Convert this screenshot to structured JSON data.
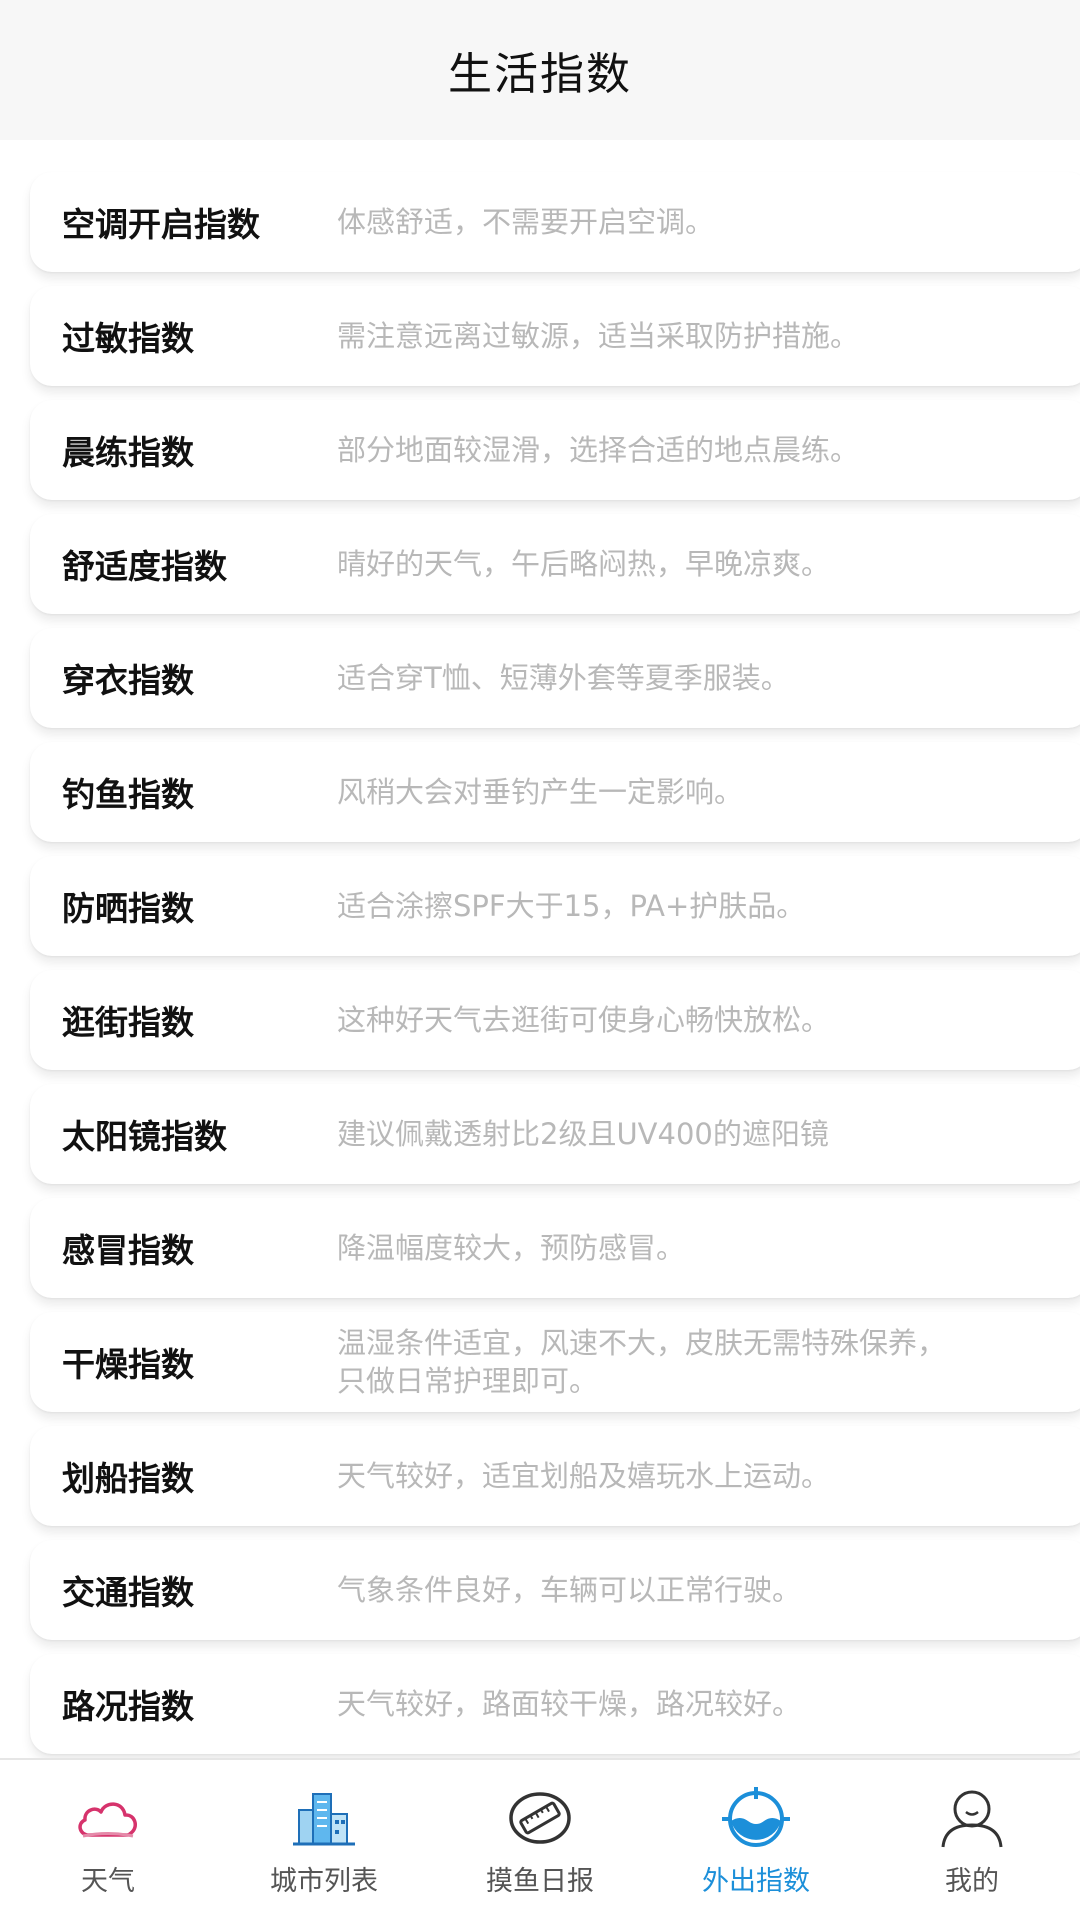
{
  "header": {
    "title": "生活指数"
  },
  "indices": [
    {
      "name": "空调开启指数",
      "desc": "体感舒适，不需要开启空调。"
    },
    {
      "name": "过敏指数",
      "desc": "需注意远离过敏源，适当采取防护措施。"
    },
    {
      "name": "晨练指数",
      "desc": "部分地面较湿滑，选择合适的地点晨练。"
    },
    {
      "name": "舒适度指数",
      "desc": "晴好的天气，午后略闷热，早晚凉爽。"
    },
    {
      "name": "穿衣指数",
      "desc": "适合穿T恤、短薄外套等夏季服装。"
    },
    {
      "name": "钓鱼指数",
      "desc": "风稍大会对垂钓产生一定影响。"
    },
    {
      "name": "防晒指数",
      "desc": "适合涂擦SPF大于15，PA+护肤品。"
    },
    {
      "name": "逛街指数",
      "desc": "这种好天气去逛街可使身心畅快放松。"
    },
    {
      "name": "太阳镜指数",
      "desc": "建议佩戴透射比2级且UV400的遮阳镜"
    },
    {
      "name": "感冒指数",
      "desc": "降温幅度较大，预防感冒。"
    },
    {
      "name": "干燥指数",
      "desc": "温湿条件适宜，风速不大，皮肤无需特殊保养，\n只做日常护理即可。"
    },
    {
      "name": "划船指数",
      "desc": "天气较好，适宜划船及嬉玩水上运动。"
    },
    {
      "name": "交通指数",
      "desc": "气象条件良好，车辆可以正常行驶。"
    },
    {
      "name": "路况指数",
      "desc": "天气较好，路面较干燥，路况较好。"
    }
  ],
  "tabbar": {
    "active_index": 3,
    "active_color": "#1c8fd9",
    "tabs": [
      {
        "label": "天气",
        "icon": "cloud-icon"
      },
      {
        "label": "城市列表",
        "icon": "city-buildings-icon"
      },
      {
        "label": "摸鱼日报",
        "icon": "ruler-badge-icon"
      },
      {
        "label": "外出指数",
        "icon": "target-water-icon"
      },
      {
        "label": "我的",
        "icon": "user-avatar-icon"
      }
    ]
  }
}
